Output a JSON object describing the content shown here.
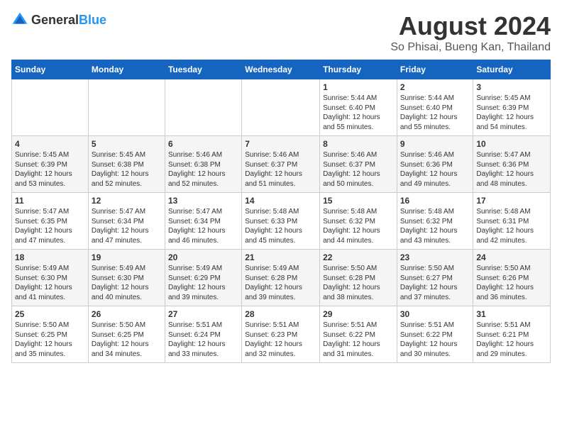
{
  "header": {
    "logo_general": "General",
    "logo_blue": "Blue",
    "month_year": "August 2024",
    "location": "So Phisai, Bueng Kan, Thailand"
  },
  "days_of_week": [
    "Sunday",
    "Monday",
    "Tuesday",
    "Wednesday",
    "Thursday",
    "Friday",
    "Saturday"
  ],
  "weeks": [
    [
      {
        "day": "",
        "info": ""
      },
      {
        "day": "",
        "info": ""
      },
      {
        "day": "",
        "info": ""
      },
      {
        "day": "",
        "info": ""
      },
      {
        "day": "1",
        "info": "Sunrise: 5:44 AM\nSunset: 6:40 PM\nDaylight: 12 hours\nand 55 minutes."
      },
      {
        "day": "2",
        "info": "Sunrise: 5:44 AM\nSunset: 6:40 PM\nDaylight: 12 hours\nand 55 minutes."
      },
      {
        "day": "3",
        "info": "Sunrise: 5:45 AM\nSunset: 6:39 PM\nDaylight: 12 hours\nand 54 minutes."
      }
    ],
    [
      {
        "day": "4",
        "info": "Sunrise: 5:45 AM\nSunset: 6:39 PM\nDaylight: 12 hours\nand 53 minutes."
      },
      {
        "day": "5",
        "info": "Sunrise: 5:45 AM\nSunset: 6:38 PM\nDaylight: 12 hours\nand 52 minutes."
      },
      {
        "day": "6",
        "info": "Sunrise: 5:46 AM\nSunset: 6:38 PM\nDaylight: 12 hours\nand 52 minutes."
      },
      {
        "day": "7",
        "info": "Sunrise: 5:46 AM\nSunset: 6:37 PM\nDaylight: 12 hours\nand 51 minutes."
      },
      {
        "day": "8",
        "info": "Sunrise: 5:46 AM\nSunset: 6:37 PM\nDaylight: 12 hours\nand 50 minutes."
      },
      {
        "day": "9",
        "info": "Sunrise: 5:46 AM\nSunset: 6:36 PM\nDaylight: 12 hours\nand 49 minutes."
      },
      {
        "day": "10",
        "info": "Sunrise: 5:47 AM\nSunset: 6:36 PM\nDaylight: 12 hours\nand 48 minutes."
      }
    ],
    [
      {
        "day": "11",
        "info": "Sunrise: 5:47 AM\nSunset: 6:35 PM\nDaylight: 12 hours\nand 47 minutes."
      },
      {
        "day": "12",
        "info": "Sunrise: 5:47 AM\nSunset: 6:34 PM\nDaylight: 12 hours\nand 47 minutes."
      },
      {
        "day": "13",
        "info": "Sunrise: 5:47 AM\nSunset: 6:34 PM\nDaylight: 12 hours\nand 46 minutes."
      },
      {
        "day": "14",
        "info": "Sunrise: 5:48 AM\nSunset: 6:33 PM\nDaylight: 12 hours\nand 45 minutes."
      },
      {
        "day": "15",
        "info": "Sunrise: 5:48 AM\nSunset: 6:32 PM\nDaylight: 12 hours\nand 44 minutes."
      },
      {
        "day": "16",
        "info": "Sunrise: 5:48 AM\nSunset: 6:32 PM\nDaylight: 12 hours\nand 43 minutes."
      },
      {
        "day": "17",
        "info": "Sunrise: 5:48 AM\nSunset: 6:31 PM\nDaylight: 12 hours\nand 42 minutes."
      }
    ],
    [
      {
        "day": "18",
        "info": "Sunrise: 5:49 AM\nSunset: 6:30 PM\nDaylight: 12 hours\nand 41 minutes."
      },
      {
        "day": "19",
        "info": "Sunrise: 5:49 AM\nSunset: 6:30 PM\nDaylight: 12 hours\nand 40 minutes."
      },
      {
        "day": "20",
        "info": "Sunrise: 5:49 AM\nSunset: 6:29 PM\nDaylight: 12 hours\nand 39 minutes."
      },
      {
        "day": "21",
        "info": "Sunrise: 5:49 AM\nSunset: 6:28 PM\nDaylight: 12 hours\nand 39 minutes."
      },
      {
        "day": "22",
        "info": "Sunrise: 5:50 AM\nSunset: 6:28 PM\nDaylight: 12 hours\nand 38 minutes."
      },
      {
        "day": "23",
        "info": "Sunrise: 5:50 AM\nSunset: 6:27 PM\nDaylight: 12 hours\nand 37 minutes."
      },
      {
        "day": "24",
        "info": "Sunrise: 5:50 AM\nSunset: 6:26 PM\nDaylight: 12 hours\nand 36 minutes."
      }
    ],
    [
      {
        "day": "25",
        "info": "Sunrise: 5:50 AM\nSunset: 6:25 PM\nDaylight: 12 hours\nand 35 minutes."
      },
      {
        "day": "26",
        "info": "Sunrise: 5:50 AM\nSunset: 6:25 PM\nDaylight: 12 hours\nand 34 minutes."
      },
      {
        "day": "27",
        "info": "Sunrise: 5:51 AM\nSunset: 6:24 PM\nDaylight: 12 hours\nand 33 minutes."
      },
      {
        "day": "28",
        "info": "Sunrise: 5:51 AM\nSunset: 6:23 PM\nDaylight: 12 hours\nand 32 minutes."
      },
      {
        "day": "29",
        "info": "Sunrise: 5:51 AM\nSunset: 6:22 PM\nDaylight: 12 hours\nand 31 minutes."
      },
      {
        "day": "30",
        "info": "Sunrise: 5:51 AM\nSunset: 6:22 PM\nDaylight: 12 hours\nand 30 minutes."
      },
      {
        "day": "31",
        "info": "Sunrise: 5:51 AM\nSunset: 6:21 PM\nDaylight: 12 hours\nand 29 minutes."
      }
    ]
  ]
}
